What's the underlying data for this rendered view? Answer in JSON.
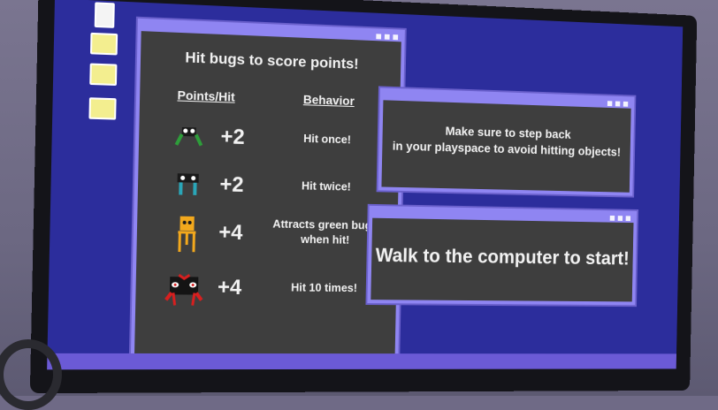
{
  "instructions_window": {
    "heading": "Hit bugs to score points!",
    "col_points": "Points/Hit",
    "col_behavior": "Behavior",
    "rows": [
      {
        "sprite": "green-bug-icon",
        "color": "#2e9d3a",
        "points": "+2",
        "behavior": "Hit once!"
      },
      {
        "sprite": "blue-bug-icon",
        "color": "#2aa6b8",
        "points": "+2",
        "behavior": "Hit twice!"
      },
      {
        "sprite": "yellow-bug-icon",
        "color": "#f2a81d",
        "points": "+4",
        "behavior": "Attracts green bugs when hit!"
      },
      {
        "sprite": "red-black-bug-icon",
        "color": "#d81f1f",
        "points": "+4",
        "behavior": "Hit 10 times!"
      }
    ]
  },
  "safety_window": {
    "line1": "Make sure to step back",
    "line2": "in your playspace to avoid hitting objects!"
  },
  "start_window": {
    "message": "Walk to the computer to start!"
  },
  "colors": {
    "screen": "#2c2d9c",
    "window_frame": "#8f85f2",
    "window_body": "#3e3e3e",
    "taskbar": "#6b5ad6"
  }
}
